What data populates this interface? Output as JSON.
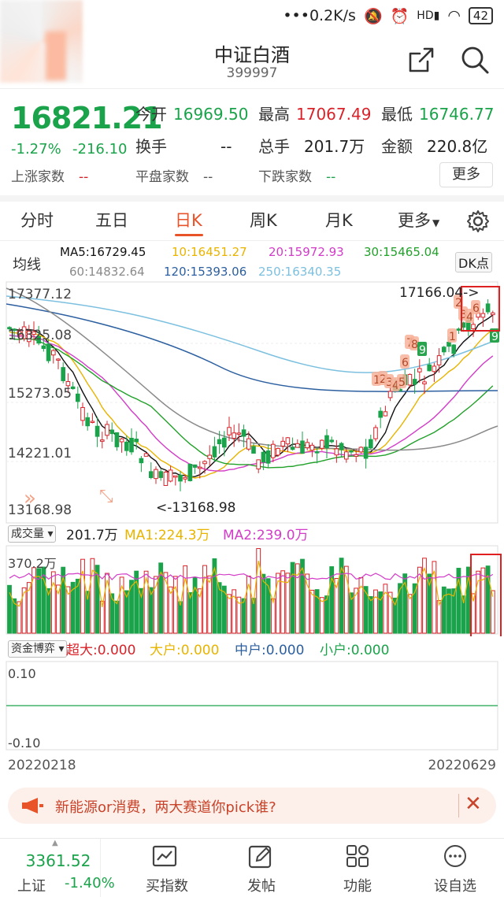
{
  "status_bar": {
    "speed": "•••0.2K/s",
    "battery": "42"
  },
  "header": {
    "title": "中证白酒",
    "code": "399997"
  },
  "quote": {
    "price": "16821.21",
    "change_pct": "-1.27%",
    "change_abs": "-216.10",
    "open_label": "今开",
    "open": "16969.50",
    "high_label": "最高",
    "high": "17067.49",
    "low_label": "最低",
    "low": "16746.77",
    "turnover_label": "换手",
    "turnover": "--",
    "volume_label": "总手",
    "volume": "201.7万",
    "amount_label": "金额",
    "amount": "220.8亿",
    "up_label": "上涨家数",
    "up": "--",
    "flat_label": "平盘家数",
    "flat": "--",
    "down_label": "下跌家数",
    "down": "--",
    "more_label": "更多"
  },
  "tabs": [
    "分时",
    "五日",
    "日K",
    "周K",
    "月K",
    "更多"
  ],
  "active_tab": "日K",
  "ma": {
    "label": "均线",
    "ma5": "MA5:16729.45",
    "ma10": "10:16451.27",
    "ma20": "20:15972.93",
    "ma30": "30:15465.04",
    "ma60": "60:14832.64",
    "ma120": "120:15393.06",
    "ma250": "250:16340.35",
    "dk": "DK点"
  },
  "price_axis": [
    "17377.12",
    "16325.08",
    "15273.05",
    "14221.01",
    "13168.98"
  ],
  "annotations": {
    "high": "17166.04->",
    "low": "<-13168.98"
  },
  "volume": {
    "selector": "成交量",
    "value": "201.7万",
    "ma1": "MA1:224.3万",
    "ma2": "MA2:239.0万",
    "axis_top": "370.2万"
  },
  "fund": {
    "selector": "资金博弈",
    "super": "超大:0.000",
    "large": "大户:0.000",
    "mid": "中户:0.000",
    "small": "小户:0.000",
    "axis_top": "0.10",
    "axis_bottom": "-0.10"
  },
  "dates": {
    "start": "20220218",
    "end": "20220629"
  },
  "banner": {
    "text": "新能源or消费，两大赛道你pick谁?"
  },
  "bottom_nav": {
    "index_value": "3361.52",
    "index_name": "上证",
    "index_change": "-1.40%",
    "items": [
      "买指数",
      "发帖",
      "功能",
      "设自选"
    ]
  },
  "colors": {
    "up": "#d8232a",
    "down": "#1aa34a",
    "accent": "#e8532a",
    "ma5": "#111111",
    "ma10": "#e8b400",
    "ma20": "#d23cc8",
    "ma30": "#22a12a",
    "ma60": "#8a8a8a",
    "ma120": "#2c5fa0",
    "ma250": "#7cc0e0"
  }
}
